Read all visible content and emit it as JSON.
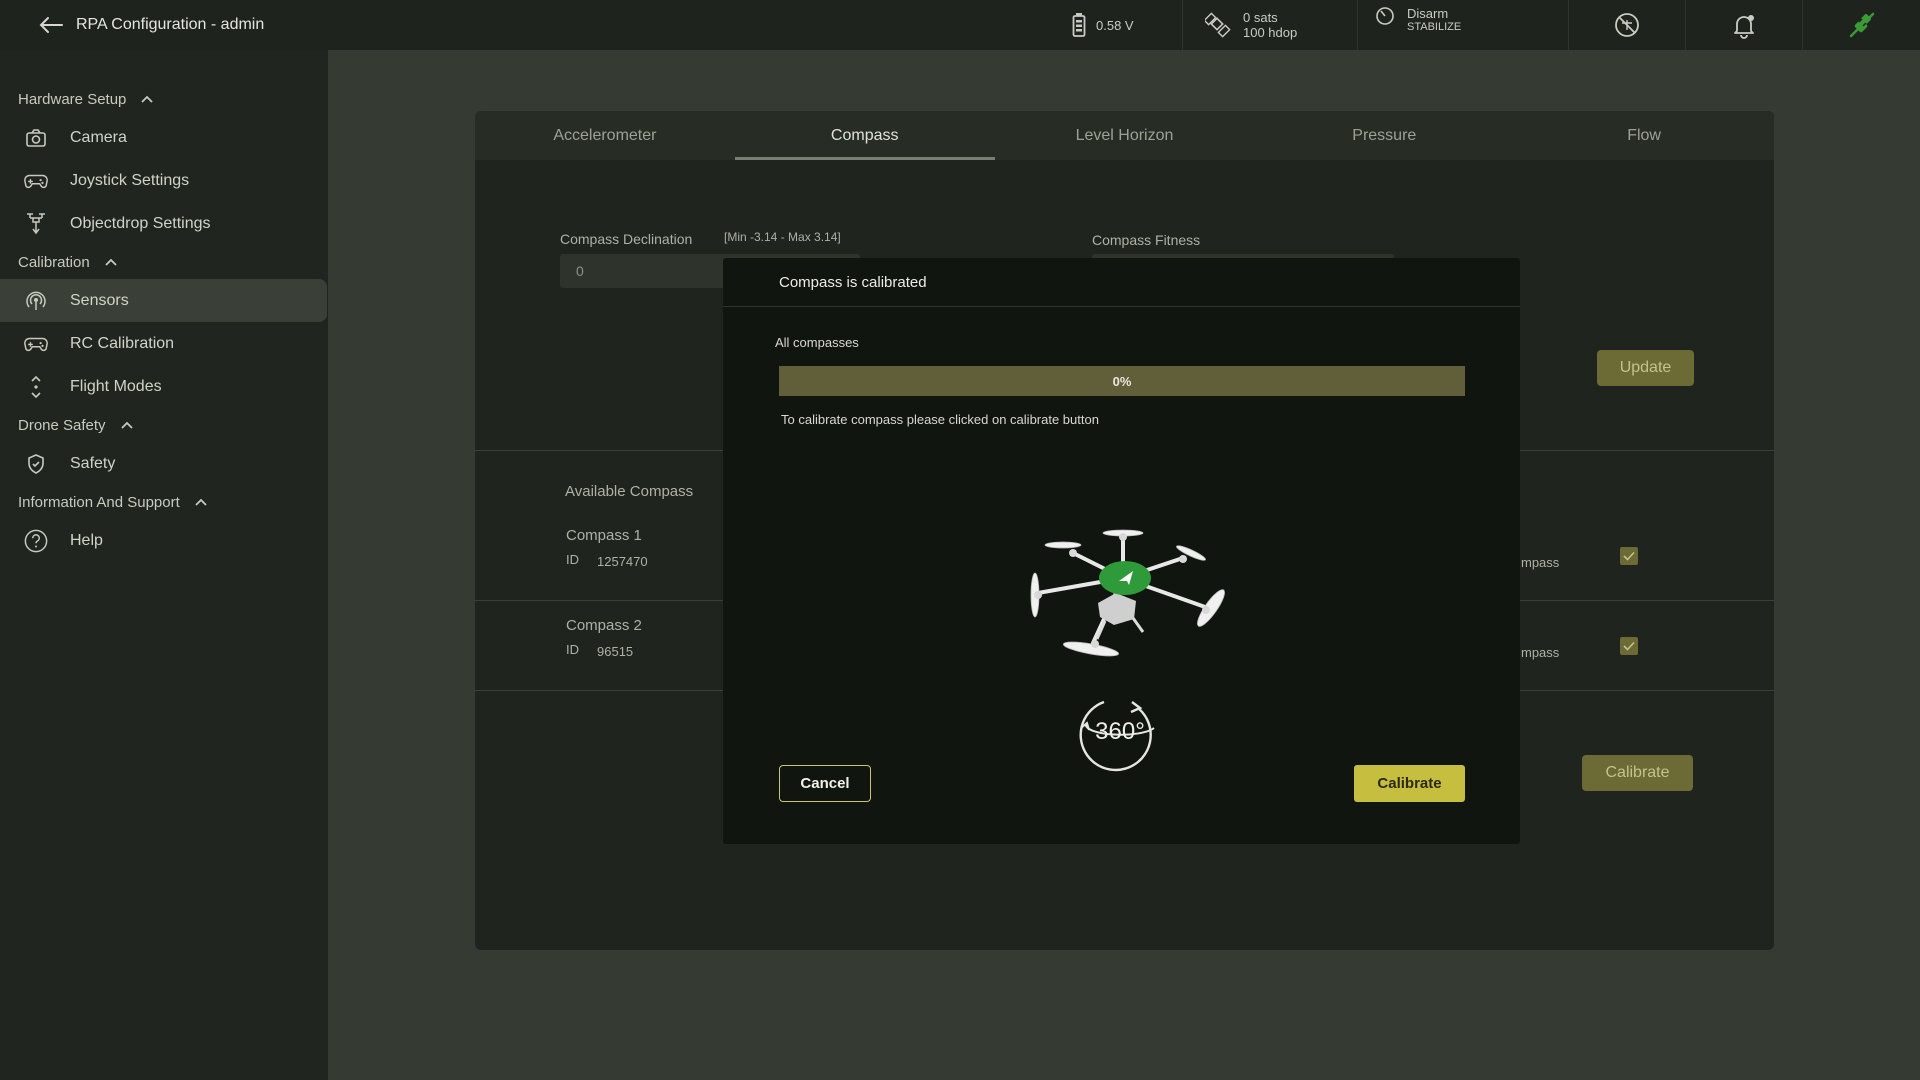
{
  "app": {
    "title": "RPA Configuration - admin"
  },
  "status": {
    "battery": "0.58 V",
    "gps_sats": "0 sats",
    "gps_hdop": "100 hdop",
    "arm_state": "Disarm",
    "flight_mode": "STABILIZE"
  },
  "sidebar": {
    "sections": [
      {
        "title": "Hardware Setup",
        "items": [
          {
            "label": "Camera",
            "icon": "camera-icon"
          },
          {
            "label": "Joystick Settings",
            "icon": "gamepad-icon"
          },
          {
            "label": "Objectdrop Settings",
            "icon": "drone-drop-icon"
          }
        ]
      },
      {
        "title": "Calibration",
        "items": [
          {
            "label": "Sensors",
            "icon": "sensor-icon",
            "active": true
          },
          {
            "label": "RC Calibration",
            "icon": "gamepad-icon"
          },
          {
            "label": "Flight Modes",
            "icon": "flight-modes-icon"
          }
        ]
      },
      {
        "title": "Drone Safety",
        "items": [
          {
            "label": "Safety",
            "icon": "shield-icon"
          }
        ]
      },
      {
        "title": "Information And Support",
        "items": [
          {
            "label": "Help",
            "icon": "help-icon"
          }
        ]
      }
    ]
  },
  "tabs": [
    "Accelerometer",
    "Compass",
    "Level Horizon",
    "Pressure",
    "Flow"
  ],
  "active_tab": "Compass",
  "compass_panel": {
    "declination_label": "Compass Declination",
    "declination_range": "[Min -3.14 - Max 3.14]",
    "declination_value": "0",
    "fitness_label": "Compass Fitness",
    "update_label": "Update",
    "available_label": "Available Compass",
    "compasses": [
      {
        "name": "Compass 1",
        "id_label": "ID",
        "id": "1257470",
        "use_label": "mpass"
      },
      {
        "name": "Compass 2",
        "id_label": "ID",
        "id": "96515",
        "use_label": "mpass"
      }
    ],
    "calibrate_label": "Calibrate"
  },
  "modal": {
    "title": "Compass is calibrated",
    "group_label": "All compasses",
    "progress_text": "0%",
    "progress_value": 0,
    "help_text": "To calibrate compass please clicked on calibrate button",
    "rotation_label": "360°",
    "cancel_label": "Cancel",
    "calibrate_label": "Calibrate"
  },
  "colors": {
    "accent": "#c6be3e",
    "sidebar_bg": "#20251f",
    "content_bg": "#353a33",
    "drone_green": "#2f9a3a"
  }
}
